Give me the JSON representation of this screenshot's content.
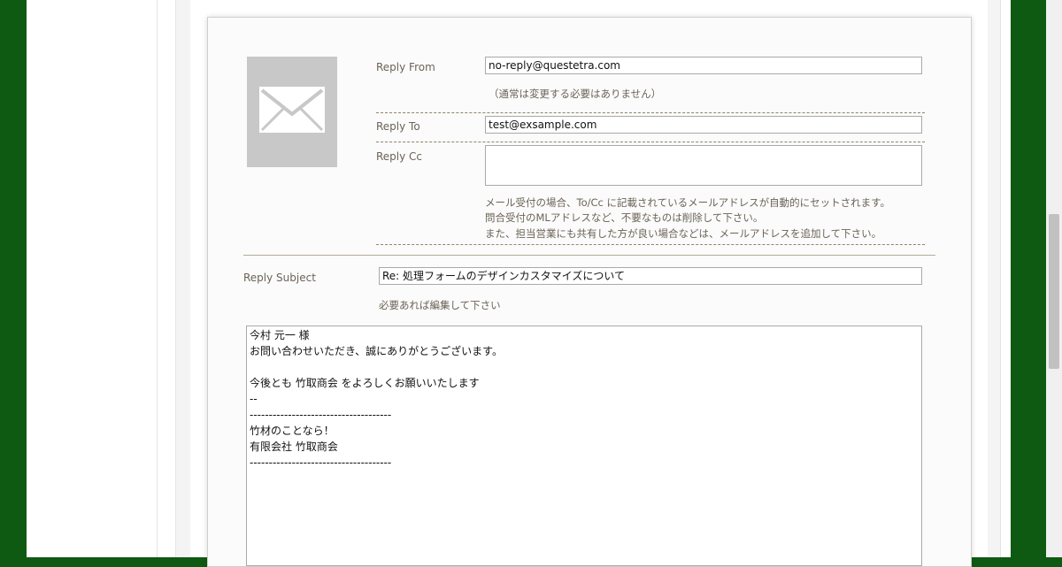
{
  "reply_from": {
    "label": "Reply From",
    "value": "no-reply@questetra.com",
    "note": "（通常は変更する必要はありません）"
  },
  "reply_to": {
    "label": "Reply To",
    "value": "test@exsample.com"
  },
  "reply_cc": {
    "label": "Reply Cc",
    "value": "",
    "notes": [
      "メール受付の場合、To/Cc に記載されているメールアドレスが自動的にセットされます。",
      "問合受付のMLアドレスなど、不要なものは削除して下さい。",
      "また、担当営業にも共有した方が良い場合などは、メールアドレスを追加して下さい。"
    ]
  },
  "reply_subject": {
    "label": "Reply Subject",
    "value": "Re: 処理フォームのデザインカスタマイズについて",
    "note": "必要あれば編集して下さい"
  },
  "reply_body": {
    "lines": [
      "今村 元一 様",
      "お問い合わせいただき、誠にありがとうございます。",
      "",
      "今後とも 竹取商会 をよろしくお願いいたします",
      "--",
      "-------------------------------------",
      "竹材のことなら！",
      "有限会社 竹取商会",
      "-------------------------------------"
    ]
  },
  "icon": "mail-envelope-stamp-icon",
  "colors": {
    "outer_background": "#0f5a12",
    "label_text": "#6b6357",
    "stamp_gray": "#c8c8c8"
  }
}
